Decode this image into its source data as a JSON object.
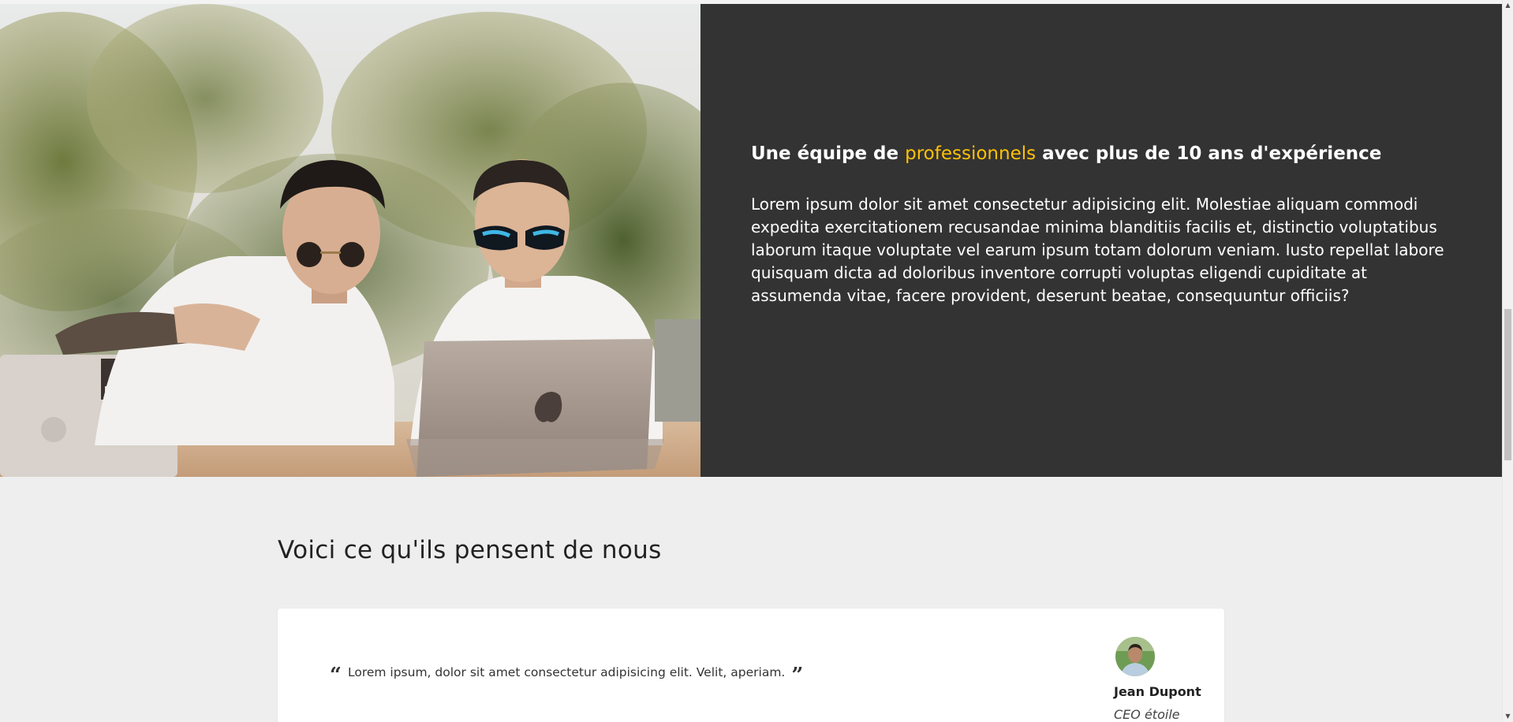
{
  "hero": {
    "heading_before": "Une équipe de ",
    "heading_accent": "professionnels",
    "heading_after": " avec plus de 10 ans d'expérience",
    "paragraph": "Lorem ipsum dolor sit amet consectetur adipisicing elit. Molestiae aliquam commodi expedita exercitationem recusandae minima blanditiis facilis et, distinctio voluptatibus laborum itaque voluptate vel earum ipsum totam dolorum veniam. Iusto repellat labore quisquam dicta ad doloribus inventore corrupti voluptas eligendi cupiditate at assumenda vitae, facere provident, deserunt beatae, consequuntur officiis?",
    "image_icon": "team-photo",
    "colors": {
      "panel_bg": "#333333",
      "accent": "#ffc107",
      "text": "#ffffff"
    }
  },
  "testimonials": {
    "title": "Voici ce qu'ils pensent de nous",
    "items": [
      {
        "quote": "Lorem ipsum, dolor sit amet consectetur adipisicing elit. Velit, aperiam.",
        "open_quote_icon": "quote-left-icon",
        "close_quote_icon": "quote-right-icon",
        "open_quote_glyph": "“",
        "close_quote_glyph": "”",
        "author_name": "Jean Dupont",
        "author_role": "CEO étoile",
        "avatar_icon": "avatar"
      }
    ]
  },
  "scrollbar": {
    "up_glyph": "▲",
    "down_glyph": "▼"
  }
}
